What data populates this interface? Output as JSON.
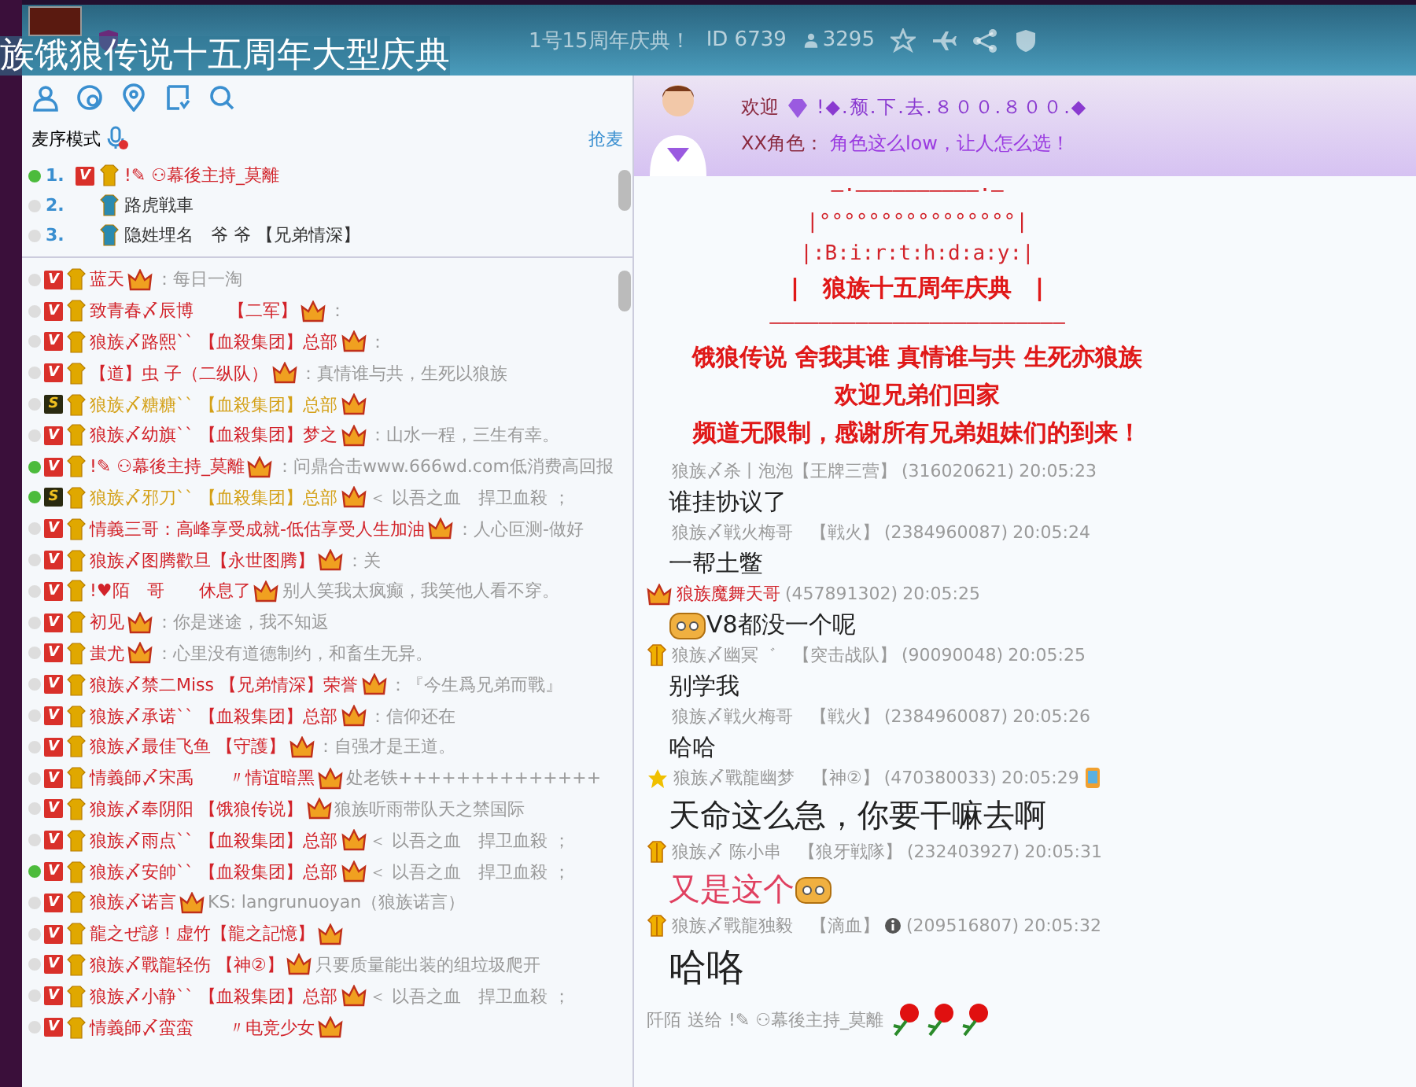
{
  "header": {
    "caption": "族饿狼传说十五周年大型庆典",
    "title": "1号15周年庆典！",
    "channel_id": "ID 6739",
    "online_count": "3295"
  },
  "left_panel": {
    "queue_mode": "麦序模式",
    "grab_mic": "抢麦",
    "queue": [
      {
        "index": "1.",
        "name": "!✎ ⚇幕後主持_莫離",
        "speaking": true,
        "badge": {
          "kind": "vip",
          "label": "V"
        },
        "color": "#d2232a"
      },
      {
        "index": "2.",
        "name": "路虎戦車",
        "speaking": false,
        "color": "#333333"
      },
      {
        "index": "3.",
        "name": "隐姓埋名　爷 爷 【兄弟情深】",
        "speaking": false,
        "color": "#333333"
      }
    ],
    "users": [
      {
        "name": "蓝天",
        "signature": "：每日一淘",
        "speaking": false,
        "badge": {
          "kind": "vip",
          "label": "V"
        },
        "color": "#d2232a"
      },
      {
        "name": "致青春〆辰博　　【二军】",
        "signature": "：",
        "speaking": false,
        "badge": {
          "kind": "vip",
          "label": "V"
        },
        "color": "#d2232a"
      },
      {
        "name": "狼族〆路熙`` 【血殺集团】总部",
        "signature": "：",
        "speaking": false,
        "badge": {
          "kind": "vip",
          "label": "V"
        },
        "color": "#d2232a"
      },
      {
        "name": "【道】虫 子（二纵队）",
        "signature": "：真情谁与共，生死以狼族",
        "speaking": false,
        "badge": {
          "kind": "vip",
          "label": "V"
        },
        "color": "#d2232a"
      },
      {
        "name": "狼族〆糖糖`` 【血殺集团】总部",
        "speaking": false,
        "badge": {
          "kind": "level",
          "label": "S"
        },
        "color": "#d4a017"
      },
      {
        "name": "狼族〆幼旗`` 【血殺集团】梦之",
        "signature": "：山水一程，三生有幸。",
        "speaking": false,
        "badge": {
          "kind": "vip",
          "label": "V"
        },
        "color": "#d2232a"
      },
      {
        "name": "!✎ ⚇幕後主持_莫離",
        "signature": "：问鼎合击www.666wd.com低消费高回报",
        "speaking": true,
        "badge": {
          "kind": "vip",
          "label": "V"
        },
        "color": "#d2232a"
      },
      {
        "name": "狼族〆邪刀`` 【血殺集团】总部",
        "signature": "＜ 以吾之血　捍卫血殺 ；",
        "speaking": true,
        "badge": {
          "kind": "level",
          "label": "S"
        },
        "color": "#d4a017"
      },
      {
        "name": "情義三哥：高峰享受成就-低估享受人生加油",
        "signature": "：人心叵测-做好",
        "speaking": false,
        "badge": {
          "kind": "vip",
          "label": "V"
        },
        "color": "#d2232a"
      },
      {
        "name": "狼族〆图腾歡旦【永世图腾】",
        "signature": "：关",
        "speaking": false,
        "badge": {
          "kind": "vip",
          "label": "V"
        },
        "color": "#d2232a"
      },
      {
        "name": "!♥陌　哥　　休息了",
        "signature": "别人笑我太疯癫，我笑他人看不穿。",
        "speaking": false,
        "badge": {
          "kind": "vip",
          "label": "V"
        },
        "color": "#d2232a"
      },
      {
        "name": "初见",
        "signature": "：你是迷途，我不知返",
        "speaking": false,
        "badge": {
          "kind": "vip",
          "label": "V"
        },
        "color": "#d2232a"
      },
      {
        "name": "蚩尤",
        "signature": "：心里没有道德制约，和畜生无异。",
        "speaking": false,
        "badge": {
          "kind": "vip",
          "label": "V"
        },
        "color": "#d2232a"
      },
      {
        "name": "狼族〆禁二Miss 【兄弟情深】荣誉",
        "signature": "：『今生爲兄弟而戰』",
        "speaking": false,
        "badge": {
          "kind": "vip",
          "label": "V"
        },
        "color": "#d2232a"
      },
      {
        "name": "狼族〆承诺`` 【血殺集团】总部",
        "signature": "：信仰还在",
        "speaking": false,
        "badge": {
          "kind": "vip",
          "label": "V"
        },
        "color": "#d2232a"
      },
      {
        "name": "狼族〆最佳飞鱼 【守護】",
        "signature": "：自强才是王道。",
        "speaking": false,
        "badge": {
          "kind": "vip",
          "label": "V"
        },
        "color": "#d2232a"
      },
      {
        "name": "情義師〆宋禹　　〃情谊暗黑",
        "signature": "处老铁++++++++++++++",
        "speaking": false,
        "badge": {
          "kind": "vip",
          "label": "V"
        },
        "color": "#d2232a"
      },
      {
        "name": "狼族〆奉阴阳 【饿狼传说】",
        "signature": "狼族听雨带队天之禁国际",
        "speaking": false,
        "badge": {
          "kind": "vip",
          "label": "V"
        },
        "color": "#d2232a"
      },
      {
        "name": "狼族〆雨点`` 【血殺集团】总部",
        "signature": "＜ 以吾之血　捍卫血殺 ；",
        "speaking": false,
        "badge": {
          "kind": "vip",
          "label": "V"
        },
        "color": "#d2232a"
      },
      {
        "name": "狼族〆安帥`` 【血殺集团】总部",
        "signature": "＜ 以吾之血　捍卫血殺 ；",
        "speaking": true,
        "badge": {
          "kind": "vip",
          "label": "V"
        },
        "color": "#d2232a"
      },
      {
        "name": "狼族〆诺言",
        "signature": "KS: langrunuoyan（狼族诺言）",
        "speaking": false,
        "badge": {
          "kind": "vip",
          "label": "V"
        },
        "color": "#d2232a"
      },
      {
        "name": "龍之ぜ諺！虚竹【龍之記憶】",
        "speaking": false,
        "badge": {
          "kind": "vip",
          "label": "V"
        },
        "color": "#d2232a"
      },
      {
        "name": "狼族〆戰龍轻伤 【神②】",
        "signature": "只要质量能出装的组垃圾爬开",
        "speaking": false,
        "badge": {
          "kind": "vip",
          "label": "V"
        },
        "color": "#d2232a"
      },
      {
        "name": "狼族〆小静`` 【血殺集团】总部",
        "signature": "＜ 以吾之血　捍卫血殺 ；",
        "speaking": false,
        "badge": {
          "kind": "vip",
          "label": "V"
        },
        "color": "#d2232a"
      },
      {
        "name": "情義師〆蛮蛮　　〃电竞少女",
        "speaking": false,
        "badge": {
          "kind": "vip",
          "label": "V"
        },
        "color": "#d2232a"
      }
    ]
  },
  "chat": {
    "banner": {
      "welcome": "欢迎",
      "nickname": "!◆.颓.下.去.８００.８００.◆",
      "role_label": "XX角色：",
      "role_text": "角色这么low，让人怎么选！"
    },
    "announcement": [
      {
        "text": "—·——————————·—",
        "kind": "art"
      },
      {
        "text": "|°°°°°°°°°°°°°°°°|",
        "kind": "art"
      },
      {
        "text": "|:B:i:r:t:h:d:a:y:|",
        "kind": "art"
      },
      {
        "text": "|　狼族十五周年庆典　|",
        "kind": "bold"
      },
      {
        "text": "————————————————————————",
        "kind": "art"
      },
      {
        "text": "饿狼传说 舍我其谁 真情谁与共 生死亦狼族",
        "kind": "bold"
      },
      {
        "text": "欢迎兄弟们回家",
        "kind": "bold"
      },
      {
        "text": "频道无限制，感谢所有兄弟姐妹们的到来！",
        "kind": "bold"
      }
    ],
    "messages": [
      {
        "sender": "狼族〆杀丨泡泡【王牌三营】",
        "qq": "(316020621)",
        "time": "20:05:23",
        "text": "谁挂协议了",
        "kind": "plain",
        "color": "#9a9a9a"
      },
      {
        "sender": "狼族〆戦火梅哥　【戦火】",
        "qq": "(2384960087)",
        "time": "20:05:24",
        "text": "一帮土鳖",
        "kind": "plain",
        "color": "#9a9a9a"
      },
      {
        "badge": {
          "kind": "crown"
        },
        "sender": "狼族魔舞天哥",
        "qq": "(457891302)",
        "time": "20:05:25",
        "text": "V8都没一个呢",
        "kind": "plain",
        "emoji_before": true,
        "color": "#d2232a"
      },
      {
        "badge": {
          "kind": "vest"
        },
        "sender": "狼族〆幽冥゛　【突击战队】",
        "qq": "(90090048)",
        "time": "20:05:25",
        "text": "别学我",
        "kind": "plain",
        "color": "#9a9a9a"
      },
      {
        "sender": "狼族〆戦火梅哥　【戦火】",
        "qq": "(2384960087)",
        "time": "20:05:26",
        "text": "哈哈",
        "kind": "plain",
        "color": "#9a9a9a"
      },
      {
        "badge": {
          "kind": "star"
        },
        "sender": "狼族〆戰龍幽梦　【神②】",
        "qq": "(470380033)",
        "time": "20:05:29",
        "text": "天命这么急，你要干嘛去啊",
        "kind": "big",
        "from_phone": true,
        "color": "#9a9a9a"
      },
      {
        "badge": {
          "kind": "vest"
        },
        "sender": "狼族〆 陈小串　【狼牙戦隊】",
        "qq": "(232403927)",
        "time": "20:05:31",
        "text": "又是这个",
        "kind": "red",
        "emoji_after": true,
        "color": "#9a9a9a"
      },
      {
        "badge": {
          "kind": "vest"
        },
        "sender": "狼族〆戰龍独毅　【滴血】",
        "qq": "(209516807)",
        "time": "20:05:32",
        "text": "哈咯",
        "kind": "huge",
        "info": true,
        "color": "#9a9a9a"
      }
    ],
    "gift": {
      "from": "阡陌",
      "verb": "送给",
      "to": "!✎ ⚇幕後主持_莫離"
    }
  }
}
